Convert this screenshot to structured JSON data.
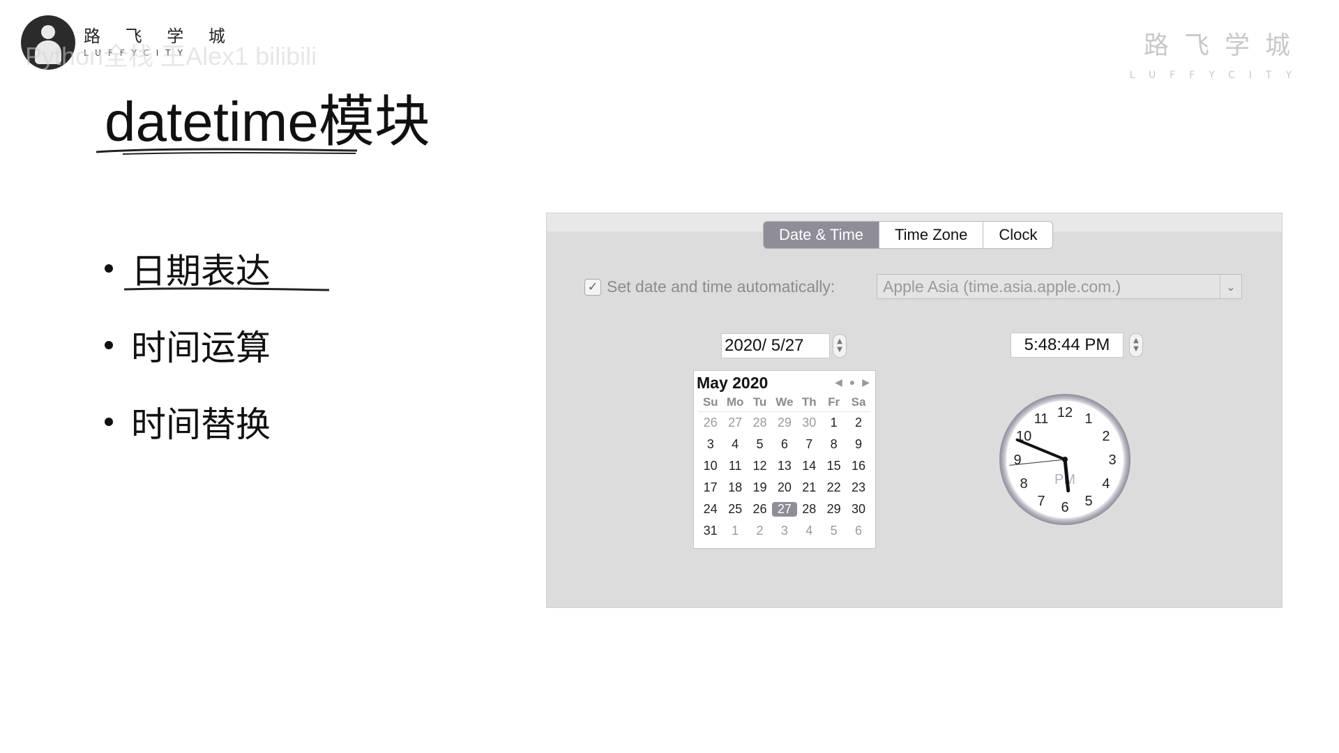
{
  "logo": {
    "cn": "路 飞 学 城",
    "en": "LUFFYCITY"
  },
  "watermark": "Python全栈 王Alex1 bilibili",
  "brand_right": {
    "cn": "路飞学城",
    "en": "LUFFYCITY"
  },
  "title": "datetime模块",
  "bullets": [
    "日期表达",
    "时间运算",
    "时间替换"
  ],
  "tabs": [
    "Date & Time",
    "Time Zone",
    "Clock"
  ],
  "active_tab": "Date & Time",
  "auto_set": {
    "checked": true,
    "label": "Set date and time automatically:",
    "server": "Apple Asia (time.asia.apple.com.)"
  },
  "date_value": "2020/  5/27",
  "time_value": "5:48:44 PM",
  "calendar": {
    "month_label": "May 2020",
    "weekdays": [
      "Su",
      "Mo",
      "Tu",
      "We",
      "Th",
      "Fr",
      "Sa"
    ],
    "weeks": [
      [
        "26",
        "27",
        "28",
        "29",
        "30",
        "1",
        "2"
      ],
      [
        "3",
        "4",
        "5",
        "6",
        "7",
        "8",
        "9"
      ],
      [
        "10",
        "11",
        "12",
        "13",
        "14",
        "15",
        "16"
      ],
      [
        "17",
        "18",
        "19",
        "20",
        "21",
        "22",
        "23"
      ],
      [
        "24",
        "25",
        "26",
        "27",
        "28",
        "29",
        "30"
      ],
      [
        "31",
        "1",
        "2",
        "3",
        "4",
        "5",
        "6"
      ]
    ],
    "selected": "27"
  },
  "clock": {
    "numbers": [
      "12",
      "1",
      "2",
      "3",
      "4",
      "5",
      "6",
      "7",
      "8",
      "9",
      "10",
      "11"
    ],
    "ampm": "PM",
    "hours": 5,
    "minutes": 48,
    "seconds": 44
  }
}
